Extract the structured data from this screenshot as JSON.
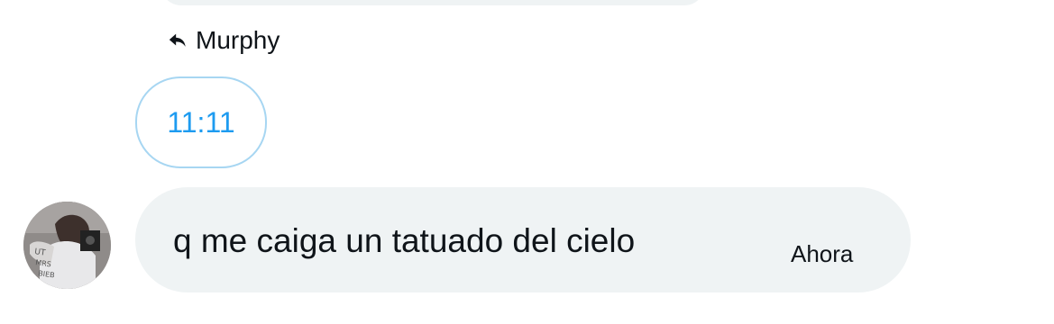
{
  "reply": {
    "icon": "reply-arrow-icon",
    "label": "Murphy"
  },
  "quoted_message": {
    "text": "11:11",
    "color": "#1d9bf0"
  },
  "message": {
    "avatar": "user-avatar",
    "text": "q me caiga un tatuado del cielo",
    "time": "Ahora",
    "bubble_color": "#eff3f4"
  }
}
